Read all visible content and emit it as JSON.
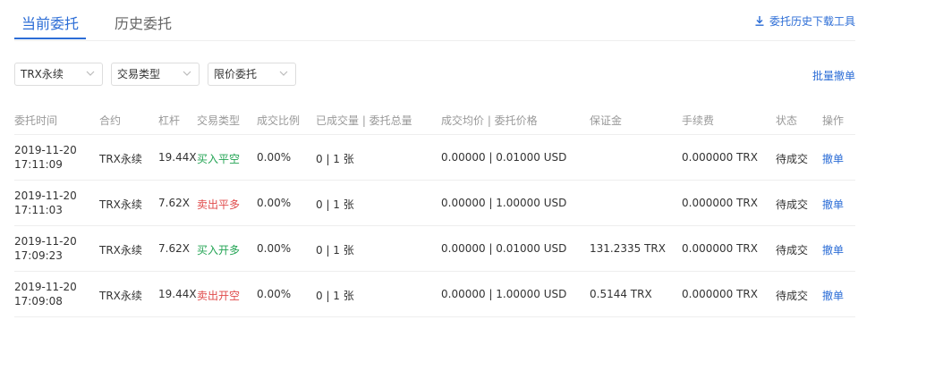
{
  "tabs": [
    {
      "label": "当前委托",
      "active": true
    },
    {
      "label": "历史委托",
      "active": false
    }
  ],
  "tool_link": {
    "label": "委托历史下载工具",
    "icon": "download-icon"
  },
  "filters": [
    {
      "value": "TRX永续"
    },
    {
      "value": "交易类型"
    },
    {
      "value": "限价委托"
    }
  ],
  "batch_cancel_label": "批量撤单",
  "colors": {
    "accent": "#2c6dd6",
    "buy": "#23a454",
    "sell": "#e04b4b"
  },
  "table": {
    "headers": [
      "委托时间",
      "合约",
      "杠杆",
      "交易类型",
      "成交比例",
      "已成交量 | 委托总量",
      "成交均价 | 委托价格",
      "保证金",
      "手续费",
      "状态",
      "操作"
    ],
    "rows": [
      {
        "date": "2019-11-20",
        "time": "17:11:09",
        "contract": "TRX永续",
        "leverage": "19.44X",
        "type": "买入平空",
        "side": "buy",
        "ratio": "0.00%",
        "volume": "0 | 1 张",
        "price": "0.00000 | 0.01000 USD",
        "margin": "",
        "fee": "0.000000 TRX",
        "status": "待成交",
        "action": "撤单"
      },
      {
        "date": "2019-11-20",
        "time": "17:11:03",
        "contract": "TRX永续",
        "leverage": "7.62X",
        "type": "卖出平多",
        "side": "sell",
        "ratio": "0.00%",
        "volume": "0 | 1 张",
        "price": "0.00000 | 1.00000 USD",
        "margin": "",
        "fee": "0.000000 TRX",
        "status": "待成交",
        "action": "撤单"
      },
      {
        "date": "2019-11-20",
        "time": "17:09:23",
        "contract": "TRX永续",
        "leverage": "7.62X",
        "type": "买入开多",
        "side": "buy",
        "ratio": "0.00%",
        "volume": "0 | 1 张",
        "price": "0.00000 | 0.01000 USD",
        "margin": "131.2335 TRX",
        "fee": "0.000000 TRX",
        "status": "待成交",
        "action": "撤单"
      },
      {
        "date": "2019-11-20",
        "time": "17:09:08",
        "contract": "TRX永续",
        "leverage": "19.44X",
        "type": "卖出开空",
        "side": "sell",
        "ratio": "0.00%",
        "volume": "0 | 1 张",
        "price": "0.00000 | 1.00000 USD",
        "margin": "0.5144 TRX",
        "fee": "0.000000 TRX",
        "status": "待成交",
        "action": "撤单"
      }
    ]
  }
}
